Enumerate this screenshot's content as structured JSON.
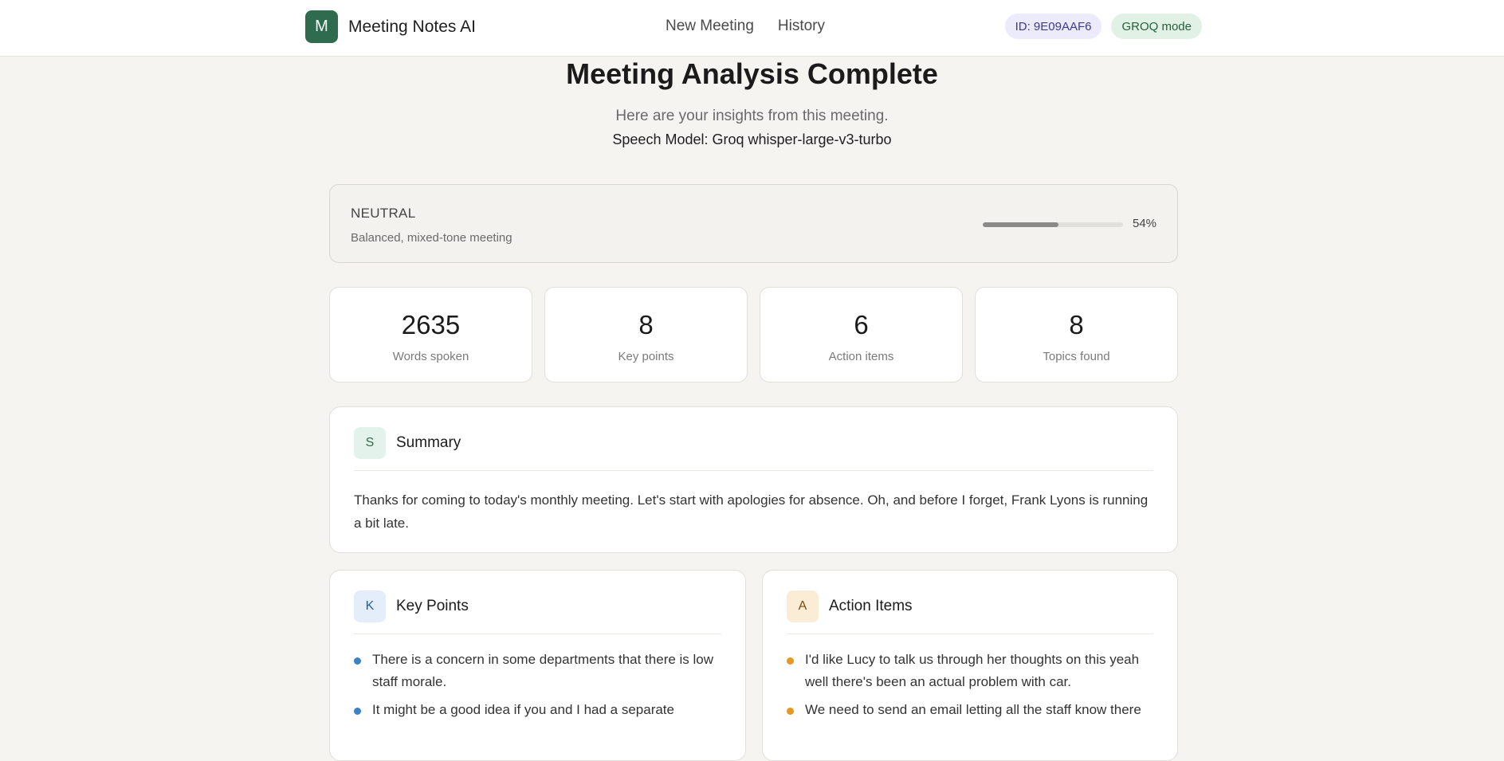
{
  "header": {
    "logo_letter": "M",
    "app_name": "Meeting Notes AI",
    "nav": [
      "New Meeting",
      "History"
    ],
    "id_badge": "ID: 9E09AAF6",
    "mode_badge": "GROQ mode"
  },
  "page": {
    "title": "Meeting Analysis Complete",
    "subtitle": "Here are your insights from this meeting.",
    "model": "Speech Model: Groq whisper-large-v3-turbo"
  },
  "sentiment": {
    "label": "NEUTRAL",
    "description": "Balanced, mixed-tone meeting",
    "percent": 54,
    "percent_label": "54%"
  },
  "stats": [
    {
      "value": "2635",
      "label": "Words spoken"
    },
    {
      "value": "8",
      "label": "Key points"
    },
    {
      "value": "6",
      "label": "Action items"
    },
    {
      "value": "8",
      "label": "Topics found"
    }
  ],
  "summary": {
    "icon_letter": "S",
    "title": "Summary",
    "text": "Thanks for coming to today's monthly meeting. Let's start with apologies for absence. Oh, and before I forget, Frank Lyons is running a bit late."
  },
  "key_points": {
    "icon_letter": "K",
    "title": "Key Points",
    "items": [
      "There is a concern in some departments that there is low staff morale.",
      "It might be a good idea if you and I had a separate"
    ]
  },
  "action_items": {
    "icon_letter": "A",
    "title": "Action Items",
    "items": [
      "I'd like Lucy to talk us through her thoughts on this yeah well there's been an actual problem with car.",
      "We need to send an email letting all the staff know there"
    ]
  },
  "colors": {
    "brand": "#2f6b4f",
    "key_point_dot": "#3b82c4",
    "action_dot": "#e8961e"
  }
}
